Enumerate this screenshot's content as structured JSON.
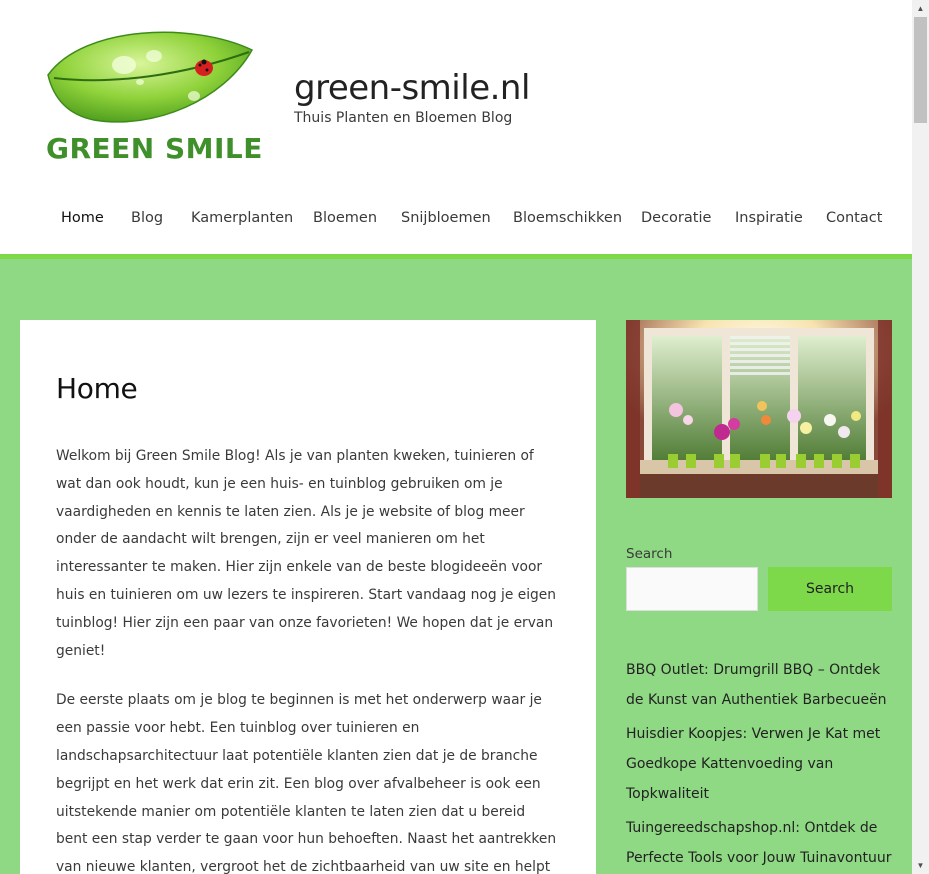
{
  "site": {
    "title": "green-smile.nl",
    "description": "Thuis Planten en Bloemen Blog",
    "logo_text": "GREEN SMILE"
  },
  "nav": {
    "items": [
      {
        "label": "Home",
        "active": true
      },
      {
        "label": "Blog"
      },
      {
        "label": "Kamerplanten"
      },
      {
        "label": "Bloemen"
      },
      {
        "label": "Snijbloemen"
      },
      {
        "label": "Bloemschikken"
      },
      {
        "label": "Decoratie"
      },
      {
        "label": "Inspiratie"
      },
      {
        "label": "Contact"
      }
    ]
  },
  "main": {
    "heading": "Home",
    "paragraphs": [
      "Welkom bij Green Smile Blog! Als je van planten kweken, tuinieren of wat dan ook houdt, kun je een huis- en tuinblog gebruiken om je vaardigheden en kennis te laten zien. Als je je website of blog meer onder de aandacht wilt brengen, zijn er veel manieren om het interessanter te maken. Hier zijn enkele van de beste blogideeën voor huis en tuinieren om uw lezers te inspireren. Start vandaag nog je eigen tuinblog! Hier zijn een paar van onze favorieten! We hopen dat je ervan geniet!",
      "De eerste plaats om je blog te beginnen is met het onderwerp waar je een passie voor hebt. Een tuinblog over tuinieren en landschapsarchitectuur laat potentiële klanten zien dat je de branche begrijpt en het werk dat erin zit. Een blog over afvalbeheer is ook een uitstekende manier om potentiële klanten te laten zien dat u bereid bent een stap verder te gaan voor hun behoeften. Naast het aantrekken van nieuwe klanten, vergroot het de zichtbaarheid van uw site en helpt het bij het opbouwen van uw autoriteit in"
    ]
  },
  "sidebar": {
    "search_label": "Search",
    "search_placeholder": "",
    "search_button": "Search",
    "posts": [
      "BBQ Outlet: Drumgrill BBQ – Ontdek de Kunst van Authentiek Barbecueën",
      "Huisdier Koopjes: Verwen Je Kat met Goedkope Kattenvoeding van Topkwaliteit",
      "Tuingereedschapshop.nl: Ontdek de Perfecte Tools voor Jouw Tuinavontuur"
    ]
  },
  "colors": {
    "accent": "#7ed94a",
    "body_background": "#8fd884",
    "text": "#3a3a3a"
  }
}
